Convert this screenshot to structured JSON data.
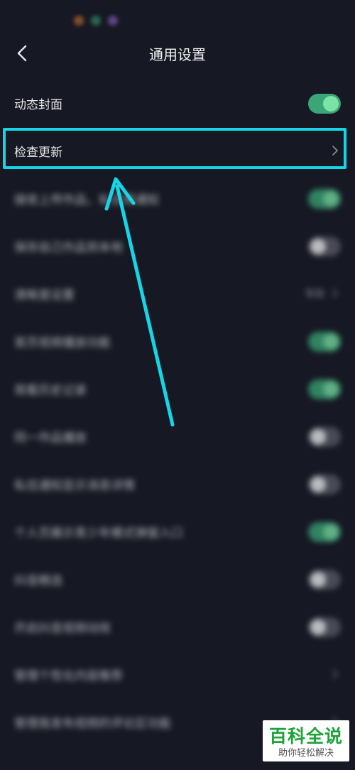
{
  "header": {
    "title": "通用设置"
  },
  "settings": [
    {
      "label": "动态封面",
      "control": "toggle",
      "state": "on"
    },
    {
      "label": "检查更新",
      "control": "chevron"
    },
    {
      "label": "接收上传作品、私信等通知",
      "control": "toggle",
      "state": "on"
    },
    {
      "label": "保存自己作品到本地",
      "control": "toggle",
      "state": "off"
    },
    {
      "label": "清晰度设置",
      "control": "chevron",
      "value": "智能"
    },
    {
      "label": "首页视频播放功能",
      "control": "toggle",
      "state": "on"
    },
    {
      "label": "观看历史记录",
      "control": "toggle",
      "state": "on"
    },
    {
      "label": "同一作品播放",
      "control": "toggle",
      "state": "off"
    },
    {
      "label": "私信通知显示消息详情",
      "control": "toggle",
      "state": "off"
    },
    {
      "label": "个人页展示青少年模式弹窗入口",
      "control": "toggle",
      "state": "on"
    },
    {
      "label": "抖音精选",
      "control": "toggle",
      "state": "off"
    },
    {
      "label": "开启抖音视频动效",
      "control": "toggle",
      "state": "off"
    },
    {
      "label": "管理个性化内容推荐",
      "control": "chevron"
    },
    {
      "label": "管理我发布视频的评论区功能",
      "control": "chevron"
    }
  ],
  "annotation": {
    "color": "#13d7e6"
  },
  "watermark": {
    "title": "百科全说",
    "subtitle": "助你轻松解决"
  }
}
